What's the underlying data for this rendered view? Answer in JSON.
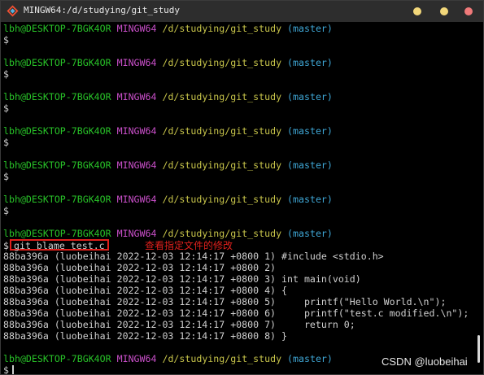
{
  "window": {
    "title": "MINGW64:/d/studying/git_study"
  },
  "prompt": {
    "user": "lbh@DESKTOP-7BGK4OR",
    "system": "MINGW64",
    "path": "/d/studying/git_study",
    "branch": "(master)",
    "symbol": "$"
  },
  "command": {
    "symbol": "$",
    "text": "git blame test.c",
    "annotation": "查看指定文件的修改"
  },
  "blame_lines": [
    "88ba396a (luobeihai 2022-12-03 12:14:17 +0800 1) #include <stdio.h>",
    "88ba396a (luobeihai 2022-12-03 12:14:17 +0800 2)",
    "88ba396a (luobeihai 2022-12-03 12:14:17 +0800 3) int main(void)",
    "88ba396a (luobeihai 2022-12-03 12:14:17 +0800 4) {",
    "88ba396a (luobeihai 2022-12-03 12:14:17 +0800 5)     printf(\"Hello World.\\n\");",
    "88ba396a (luobeihai 2022-12-03 12:14:17 +0800 6)     printf(\"test.c modified.\\n\");",
    "88ba396a (luobeihai 2022-12-03 12:14:17 +0800 7)     return 0;",
    "88ba396a (luobeihai 2022-12-03 12:14:17 +0800 8) }"
  ],
  "watermark": "CSDN @luobeihai",
  "icons": {
    "app": "git-bash-icon",
    "minimize": "minimize-icon",
    "maximize": "maximize-icon",
    "close": "close-icon"
  },
  "colors": {
    "user": "#28c228",
    "system": "#c94fc9",
    "path": "#c7c44a",
    "branch": "#3fa7d6",
    "highlight": "#e0201c"
  }
}
